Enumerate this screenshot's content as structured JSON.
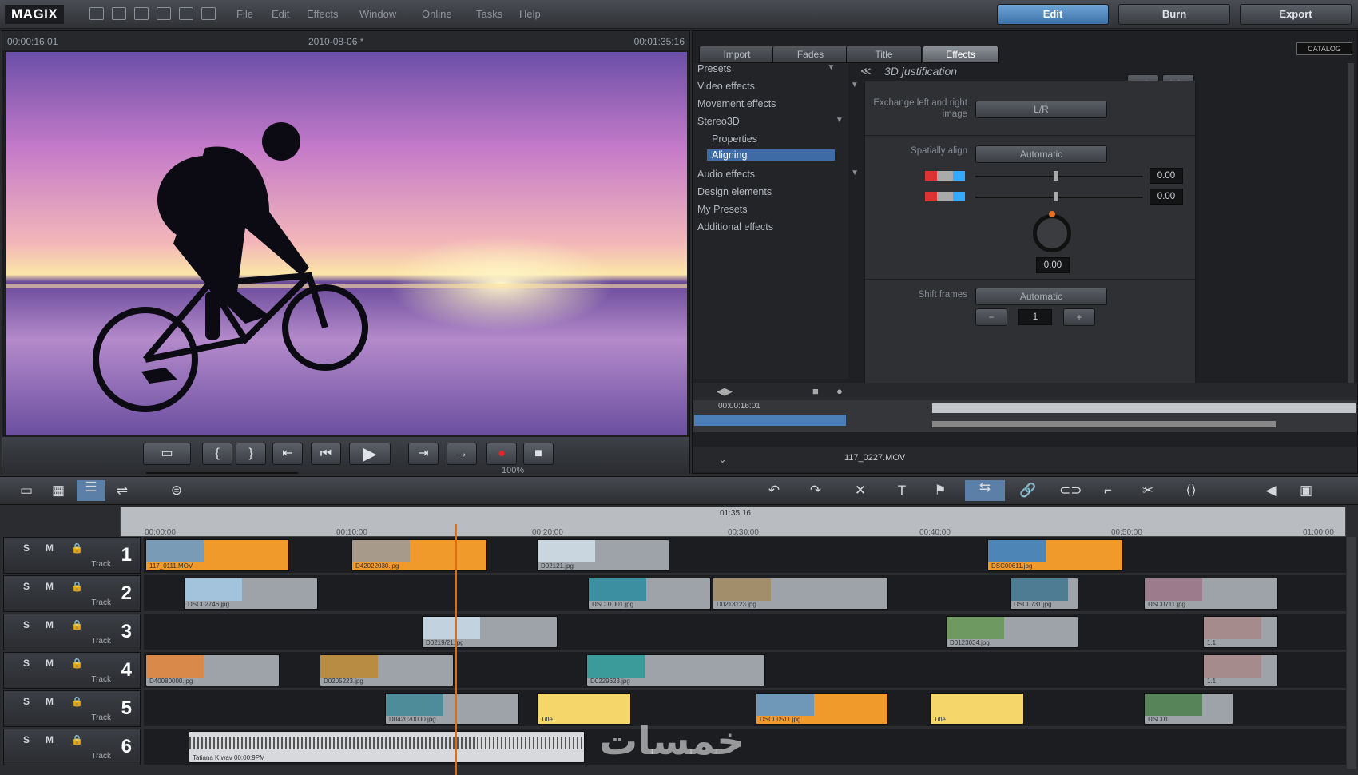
{
  "app": {
    "logo": "MAGIX"
  },
  "menu": [
    "File",
    "Edit",
    "Effects",
    "Window",
    "Online",
    "Tasks",
    "Help"
  ],
  "modes": [
    {
      "label": "Edit",
      "active": true
    },
    {
      "label": "Burn",
      "active": false
    },
    {
      "label": "Export",
      "active": false
    }
  ],
  "preview": {
    "timecode_left": "00:00:16:01",
    "date": "2010-08-06 *",
    "timecode_right": "00:01:35:16",
    "zoom": "100%"
  },
  "tabs": [
    {
      "label": "Import"
    },
    {
      "label": "Fades"
    },
    {
      "label": "Title"
    },
    {
      "label": "Effects",
      "active": true
    }
  ],
  "corner_label": "CATALOG",
  "effects_list": [
    {
      "label": "Presets"
    },
    {
      "label": "Video effects"
    },
    {
      "label": "Movement effects"
    },
    {
      "label": "Stereo3D"
    },
    {
      "label": "Properties",
      "indent": true
    },
    {
      "label": "Aligning",
      "indent": true,
      "selected": true
    },
    {
      "label": "Audio effects"
    },
    {
      "label": "Design elements"
    },
    {
      "label": "My Presets"
    },
    {
      "label": "Additional effects"
    }
  ],
  "detail": {
    "title": "3D justification",
    "exchange_label": "Exchange left and right image",
    "exchange_btn": "L/R",
    "spatially_label": "Spatially align",
    "spatially_btn": "Automatic",
    "h_value": "0.00",
    "v_value": "0.00",
    "rot_value": "0.00",
    "shift_label": "Shift frames",
    "shift_btn": "Automatic",
    "shift_value": "1",
    "minus": "−",
    "plus": "+"
  },
  "mini_timeline": {
    "timecode": "00:00:16:01",
    "file": "117_0227.MOV"
  },
  "ruler": {
    "center": "01:35:16",
    "ticks": [
      "00:00:00",
      "00:10:00",
      "00:20:00",
      "00:30:00",
      "00:40:00",
      "00:50:00",
      "01:00:00"
    ]
  },
  "tracks": [
    {
      "num": "1",
      "label": "Track"
    },
    {
      "num": "2",
      "label": "Track"
    },
    {
      "num": "3",
      "label": "Track"
    },
    {
      "num": "4",
      "label": "Track"
    },
    {
      "num": "5",
      "label": "Track"
    },
    {
      "num": "6",
      "label": "Track"
    }
  ],
  "track_controls": {
    "s": "S",
    "m": "M"
  },
  "clip_captions": {
    "c1": "117_0111.MOV",
    "c2": "D42022030.jpg",
    "c3": "D02121.jpg",
    "c4": "DSC00611.jpg",
    "c5": "DSC02746.jpg",
    "c6": "DSC01001.jpg",
    "c7": "D0213123.jpg",
    "c8": "DSC0731.jpg",
    "c9": "DSC0711.jpg",
    "c10": "D0219/21.jpg",
    "c11": "D0123034.jpg",
    "c12": "1.1",
    "c13": "D40080000.jpg",
    "c14": "D0205223.jpg",
    "c15": "D0229623.jpg",
    "c16": "1.1",
    "c17": "D042020000.jpg",
    "c18": "Title",
    "c19": "DSC00511.jpg",
    "c20": "Title",
    "c21": "DSC01",
    "c22": "Tatiana K.wav 00:00:9PM"
  },
  "watermark": "خمسات"
}
